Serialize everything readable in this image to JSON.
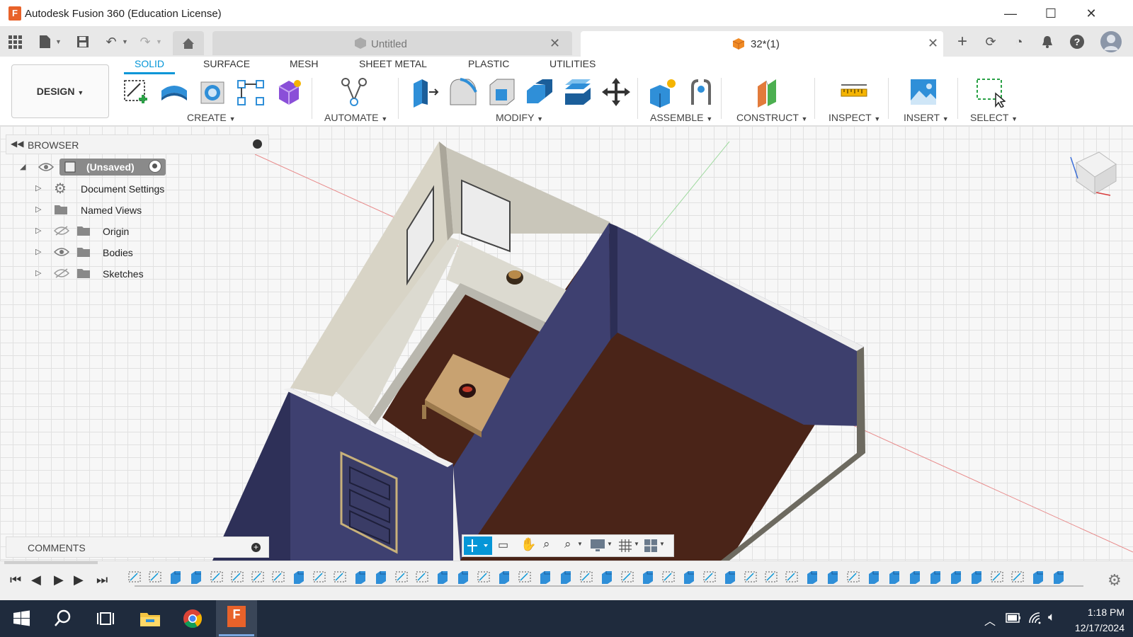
{
  "window": {
    "title": "Autodesk Fusion 360 (Education License)",
    "app_icon_letter": "F"
  },
  "tabs": [
    {
      "label": "Untitled",
      "active": false
    },
    {
      "label": "32*(1)",
      "active": true
    }
  ],
  "ribbon": {
    "workspace": "DESIGN",
    "tabs": [
      "SOLID",
      "SURFACE",
      "MESH",
      "SHEET METAL",
      "PLASTIC",
      "UTILITIES"
    ],
    "groups": [
      "CREATE",
      "AUTOMATE",
      "MODIFY",
      "ASSEMBLE",
      "CONSTRUCT",
      "INSPECT",
      "INSERT",
      "SELECT"
    ]
  },
  "browser": {
    "title": "BROWSER",
    "root": "(Unsaved)",
    "items": [
      "Document Settings",
      "Named Views",
      "Origin",
      "Bodies",
      "Sketches"
    ]
  },
  "comments": {
    "title": "COMMENTS"
  },
  "taskbar": {
    "time": "1:18 PM",
    "date": "12/17/2024"
  },
  "colors": {
    "accent": "#0696d7",
    "wall_blue": "#3d3f6d",
    "floor": "#4a2418",
    "taskbar": "#1f2b3d"
  }
}
